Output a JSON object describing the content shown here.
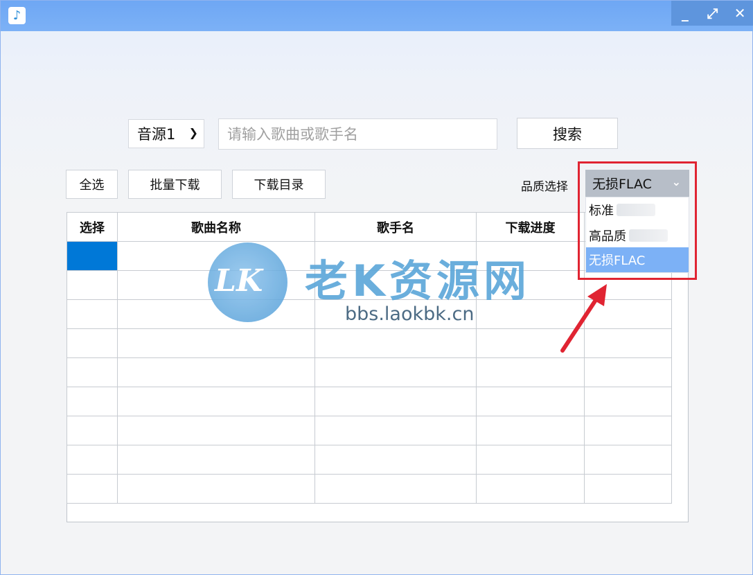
{
  "window": {
    "controls": {
      "minimize": "_",
      "maximize": "⤢",
      "close": "✕"
    }
  },
  "search": {
    "source_value": "音源1",
    "placeholder": "请输入歌曲或歌手名",
    "button_label": "搜索"
  },
  "toolbar": {
    "select_all": "全选",
    "batch_download": "批量下载",
    "download_dir": "下载目录",
    "quality_label": "品质选择"
  },
  "quality": {
    "selected": "无损FLAC",
    "options": [
      "标准",
      "高品质",
      "无损FLAC"
    ]
  },
  "table": {
    "headers": [
      "选择",
      "歌曲名称",
      "歌手名",
      "下载进度",
      ""
    ]
  },
  "watermark": {
    "logo": "LK",
    "title": "老K资源网",
    "url": "bbs.laokbk.cn"
  },
  "colors": {
    "titlebar": "#6ea7f4",
    "selection": "#0078d7",
    "highlight": "#e02432",
    "option_selected": "#7cb1f6"
  },
  "icons": {
    "app": "music-note-icon",
    "dropdown": "chevron-down-icon"
  }
}
